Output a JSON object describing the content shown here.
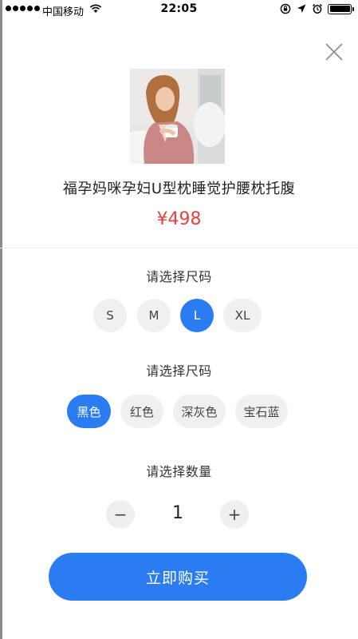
{
  "status_bar": {
    "carrier": "中国移动",
    "time": "22:05"
  },
  "product": {
    "title": "福孕妈咪孕妇U型枕睡觉护腰枕托腹",
    "price": "¥498",
    "image_icon": "product-photo"
  },
  "size_section": {
    "label": "请选择尺码",
    "options": [
      "S",
      "M",
      "L",
      "XL"
    ],
    "selected": "L"
  },
  "color_section": {
    "label": "请选择尺码",
    "options": [
      "黑色",
      "红色",
      "深灰色",
      "宝石蓝"
    ],
    "selected": "黑色"
  },
  "quantity_section": {
    "label": "请选择数量",
    "minus": "−",
    "value": "1",
    "plus": "+"
  },
  "buy_button": {
    "label": "立即购买"
  },
  "colors": {
    "accent": "#2b7cf1",
    "price": "#e8403e"
  }
}
